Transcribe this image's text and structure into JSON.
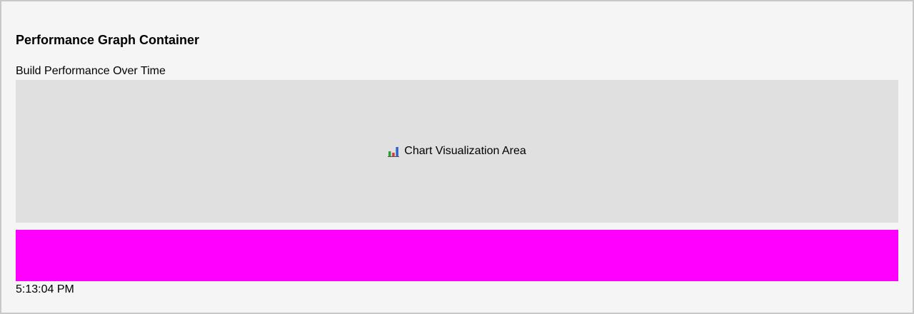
{
  "container": {
    "heading": "Performance Graph Container",
    "subtitle": "Build Performance Over Time"
  },
  "chart": {
    "icon": "bar-chart-icon",
    "placeholder": "Chart Visualization Area"
  },
  "highlight": {
    "color": "#ff00ff"
  },
  "status": {
    "timestamp": "5:13:04 PM"
  },
  "colors": {
    "background": "#f5f5f5",
    "chart_area": "#e0e0e0",
    "border": "#c8c8c8"
  }
}
